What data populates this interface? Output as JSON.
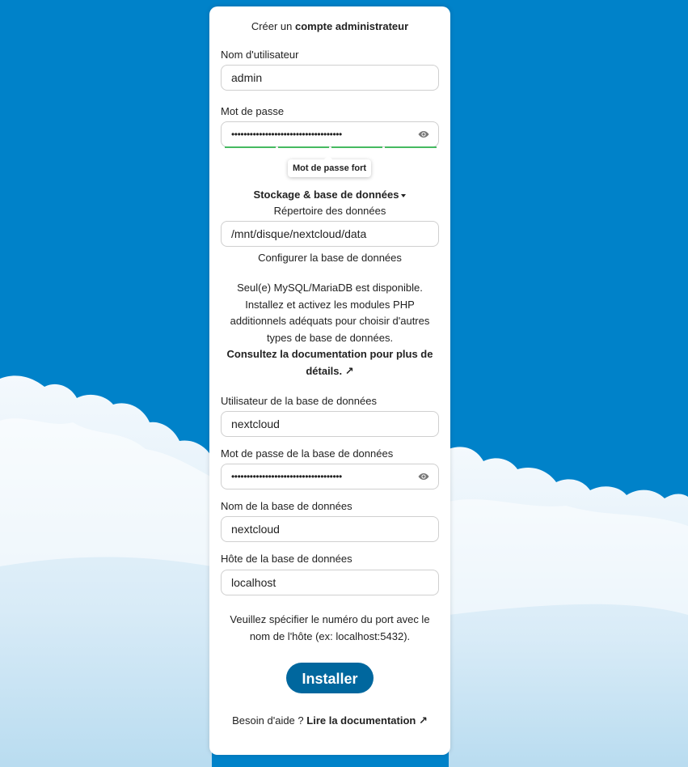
{
  "colors": {
    "background": "#0082c9",
    "primary_button": "#00679e",
    "strength_bar": "#46ba61"
  },
  "heading": {
    "prefix": "Créer un",
    "bold": "compte administrateur"
  },
  "admin_user": {
    "label": "Nom d'utilisateur",
    "value": "admin"
  },
  "admin_password": {
    "label": "Mot de passe",
    "value": "••••••••••••••••••••••••••••••••••••",
    "toggle_icon": "eye-icon",
    "strength_text": "Mot de passe fort",
    "strength_level": 1.0
  },
  "storage": {
    "toggle_label": "Stockage & base de données",
    "toggle_icon": "caret-down-icon",
    "data_dir_label": "Répertoire des données",
    "data_dir_value": "/mnt/disque/nextcloud/data",
    "configure_label": "Configurer la base de données",
    "db_notice_lines": [
      "Seul(e) MySQL/MariaDB est disponible.",
      "Installez et activez les modules PHP",
      "additionnels adéquats pour choisir d'autres",
      "types de base de données."
    ],
    "doc_link_line1": "Consultez la documentation pour plus de",
    "doc_link_line2": "détails. ↗"
  },
  "db": {
    "user_label": "Utilisateur de la base de données",
    "user_value": "nextcloud",
    "password_label": "Mot de passe de la base de données",
    "password_value": "••••••••••••••••••••••••••••••••••••",
    "name_label": "Nom de la base de données",
    "name_value": "nextcloud",
    "host_label": "Hôte de la base de données",
    "host_value": "localhost",
    "host_hint_line1": "Veuillez spécifier le numéro du port avec le",
    "host_hint_line2": "nom de l'hôte (ex: localhost:5432)."
  },
  "install_button": "Installer",
  "help": {
    "prefix": "Besoin d'aide ?",
    "link": "Lire la documentation ↗"
  }
}
